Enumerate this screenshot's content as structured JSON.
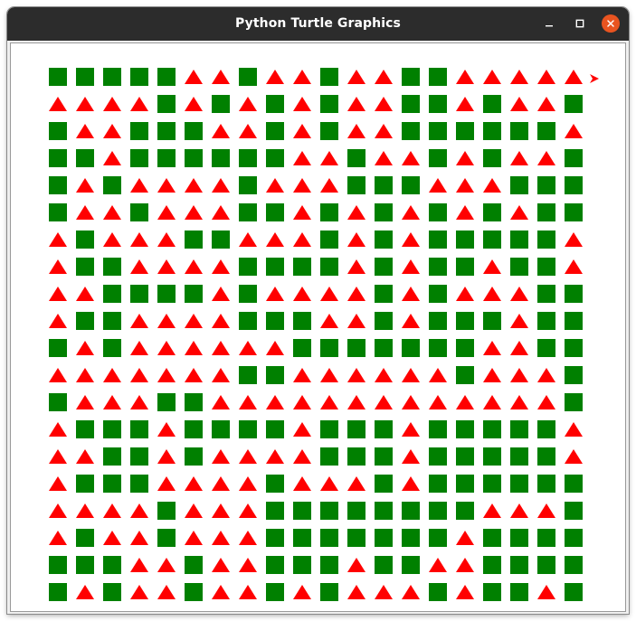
{
  "window": {
    "title": "Python Turtle Graphics",
    "controls": {
      "minimize_icon": "minimize-icon",
      "maximize_icon": "maximize-icon",
      "close_icon": "close-icon"
    }
  },
  "colors": {
    "titlebar": "#2c2c2c",
    "title_text": "#ffffff",
    "close_button": "#e95420",
    "square": "#008000",
    "triangle": "#ff0000",
    "turtle": "#ff0000",
    "canvas": "#ffffff"
  },
  "canvas": {
    "pattern": [
      "SSSSSTTSTTSTTSSTTTTT",
      "TTTTSTSTSTSTTSSTSTTS",
      "STTSSSTTSTSTTSSSSSST",
      "SSTSSSSSSTTSTTSTSTTS",
      "STSTTTTSTTTSSSTTTSSS",
      "STTSTTTSSTSTSTSTSTSS",
      "TSTTTSSTTTSTSTSSSSST",
      "TSSTTTTSSSSTSTSSTSST",
      "TTSSSSTSTTTTSTSTTTSS",
      "TSSTTTTSSSTTSTSSSTSS",
      "STSTTTTTTSSSSSSSTTSS",
      "TTTTTTTSSTTTTTTSTTTS",
      "STTTSSTTTTTTTTTTTTTS",
      "TSSSTSSSSTSSSTSSSSST",
      "TTSSTSTTTTSSSTSSSSST",
      "TSSSTTTTSTTTSTSSSSSS",
      "TTTTSTTTSSSSSSSSTTTS",
      "TSTTSTTTSSSSSSSTSSSS",
      "SSSTTSTTSSSTSSTTSSSS",
      "STSTTSTTSTSTTTSTSSTS"
    ],
    "turtle": {
      "shape": "classic",
      "heading": "east"
    }
  }
}
